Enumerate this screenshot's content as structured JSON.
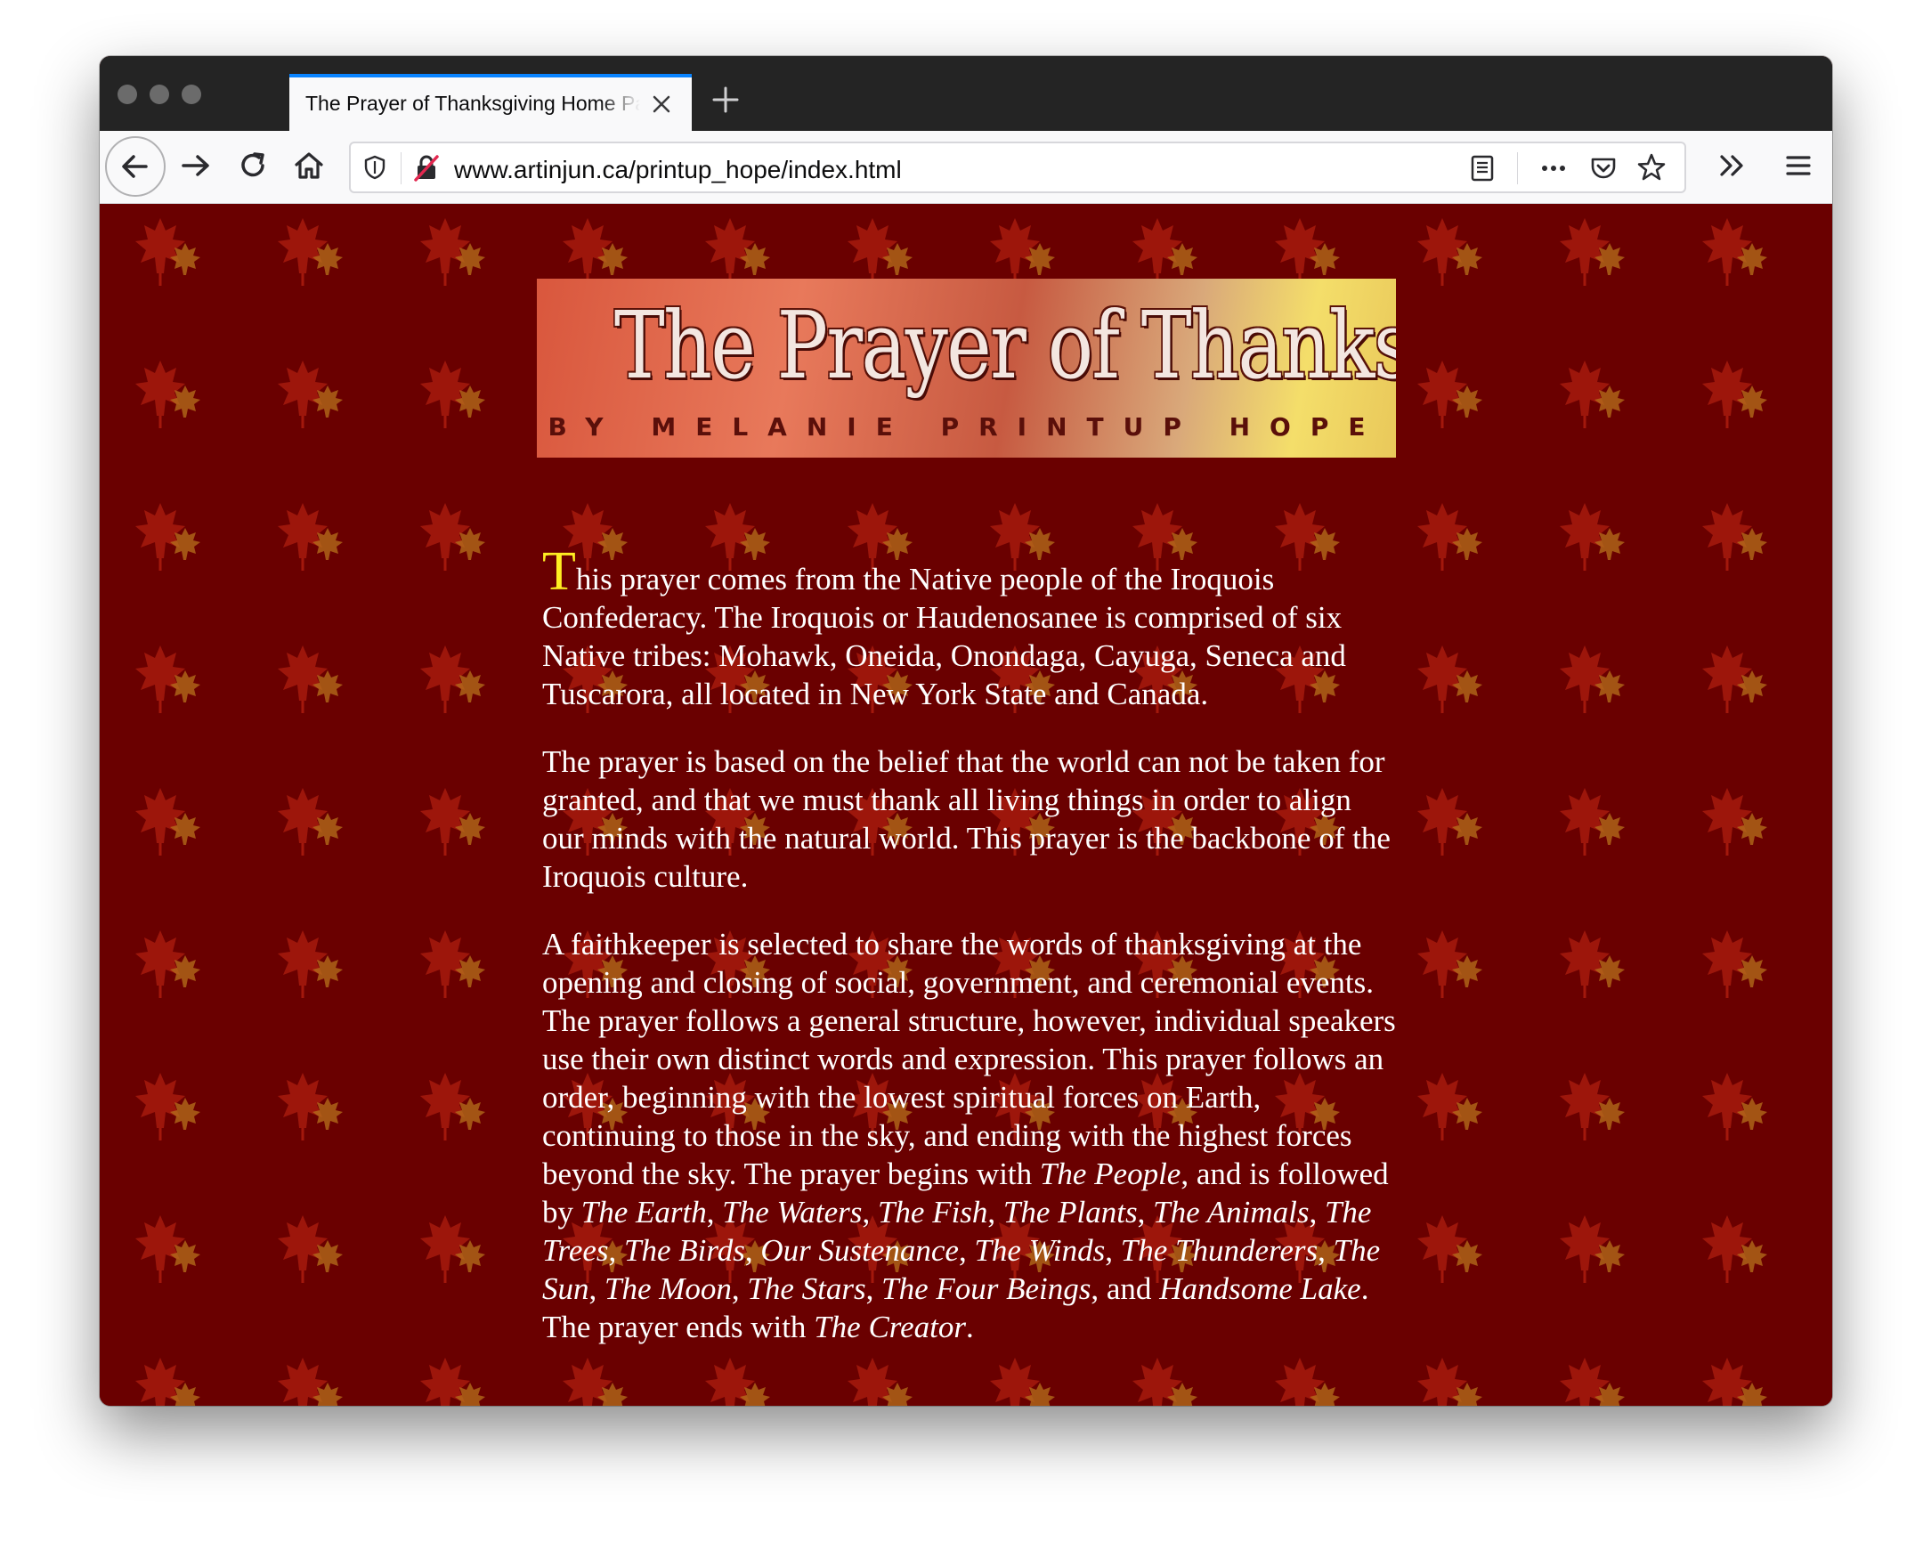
{
  "browser": {
    "tab_title": "The Prayer of Thanksgiving Home Page",
    "url": "www.artinjun.ca/printup_hope/index.html"
  },
  "banner": {
    "title": "The Prayer of Thanksgiving",
    "byline": "BY MELANIE PRINTUP HOPE"
  },
  "article": {
    "p1_dropcap": "T",
    "p1_text": "his prayer comes from the Native people of the Iroquois Confederacy. The Iroquois or Haudenosanee is comprised of six Native tribes: Mohawk, Oneida, Onondaga, Cayuga, Seneca and Tuscarora, all located in New York State and Canada.",
    "p2_text": "The prayer is based on the belief that the world can not be taken for granted, and that we must thank all living things in order to align our minds with the natural world. This prayer is the backbone of the Iroquois culture.",
    "p3_text_a": "A faithkeeper is selected to share the words of thanksgiving at the opening and closing of social, government, and ceremonial events. The prayer follows a general structure, however, individual speakers use their own distinct words and expression. This prayer follows an order, beginning with the lowest spiritual forces on Earth, continuing to those in the sky, and ending with the highest forces beyond the sky. The prayer begins with ",
    "p3_the_people": "The People",
    "p3_text_b": ", and is followed by ",
    "p3_earth": "The Earth",
    "p3_waters": "The Waters",
    "p3_fish": "The Fish",
    "p3_plants": "The Plants",
    "p3_animals": "The Animals",
    "p3_trees": "The Trees",
    "p3_birds": "The Birds",
    "p3_sustenance": "Our Sustenance",
    "p3_winds": "The Winds",
    "p3_thunderers": "The Thunderers",
    "p3_sun": "The Sun",
    "p3_moon": "The Moon",
    "p3_stars": "The Stars",
    "p3_four_beings": "The Four Beings",
    "p3_and": ", and ",
    "p3_handsome_lake": "Handsome Lake",
    "p3_text_c": ". The prayer ends with ",
    "p3_creator": "The Creator",
    "p3_end": ".",
    "comma": ", "
  },
  "colors": {
    "page_background": "#6a0000",
    "dropcap": "#ffee22",
    "tab_accent": "#0a84ff"
  }
}
